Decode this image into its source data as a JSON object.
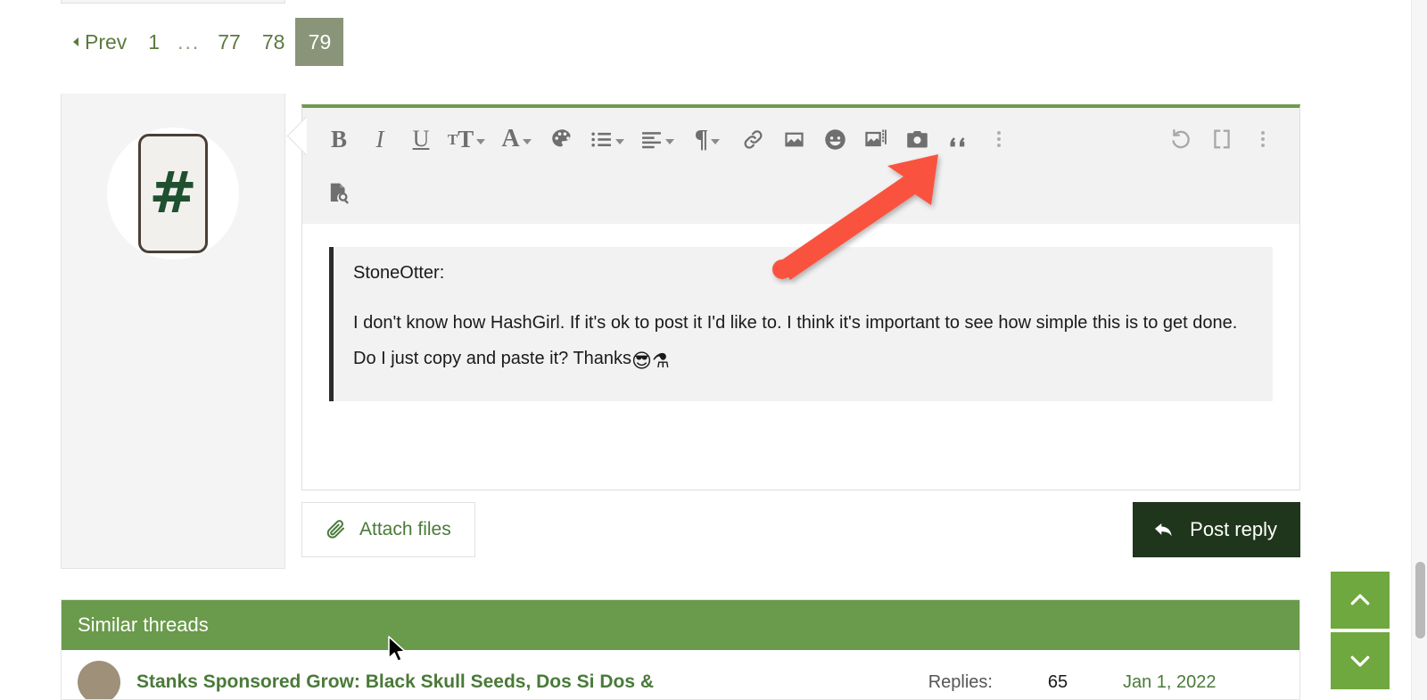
{
  "pagination": {
    "prev_label": "Prev",
    "first_page": "1",
    "ellipsis": "...",
    "page_77": "77",
    "page_78": "78",
    "current_page": "79"
  },
  "avatar": {
    "glyph": "#"
  },
  "editor": {
    "toolbar_row1": [
      {
        "name": "bold-icon",
        "label": "B"
      },
      {
        "name": "italic-icon",
        "label": "I"
      },
      {
        "name": "underline-icon",
        "label": "U"
      },
      {
        "name": "font-size-icon",
        "label": "TT"
      },
      {
        "name": "text-color-icon",
        "label": "A"
      },
      {
        "name": "palette-icon",
        "label": "Palette"
      },
      {
        "name": "list-icon",
        "label": "List"
      },
      {
        "name": "align-icon",
        "label": "Align"
      },
      {
        "name": "paragraph-icon",
        "label": "Paragraph"
      },
      {
        "name": "link-icon",
        "label": "Link"
      },
      {
        "name": "image-icon",
        "label": "Image"
      },
      {
        "name": "smilie-icon",
        "label": "Smilies"
      },
      {
        "name": "gallery-icon",
        "label": "Gallery"
      },
      {
        "name": "camera-icon",
        "label": "Camera"
      },
      {
        "name": "quote-icon",
        "label": "Quote"
      },
      {
        "name": "more-options-icon",
        "label": "More options"
      }
    ],
    "toolbar_right": [
      {
        "name": "undo-icon",
        "label": "Undo"
      },
      {
        "name": "bbcode-icon",
        "label": "[ ]"
      },
      {
        "name": "more-tools-icon",
        "label": "More"
      }
    ],
    "toolbar_row2": [
      {
        "name": "preview-icon",
        "label": "Preview"
      }
    ],
    "quote": {
      "attribution": "StoneOtter:",
      "line1": "I don't know how HashGirl. If it's ok to post it I'd like to. I think it's important to see how simple this is to get",
      "line2": "done. Do I just copy and paste it? Thanks",
      "emoji1": "😎",
      "emoji2": "⚗"
    }
  },
  "actions": {
    "attach_label": "Attach files",
    "post_label": "Post reply"
  },
  "similar_threads": {
    "heading": "Similar threads",
    "rows": [
      {
        "title": "Stanks Sponsored Grow: Black Skull Seeds, Dos Si Dos &",
        "replies_label": "Replies:",
        "replies_count": "65",
        "date": "Jan 1, 2022"
      }
    ]
  },
  "scroll_controls": {
    "up_label": "Scroll to top",
    "down_label": "Scroll to bottom"
  },
  "colors": {
    "accent_green": "#6a9a4b",
    "link_green": "#4a7a39",
    "dark_green": "#20361c",
    "current_page_bg": "#8a9478",
    "annotation_red": "#f9523f",
    "scroll_button": "#6fa83e"
  }
}
